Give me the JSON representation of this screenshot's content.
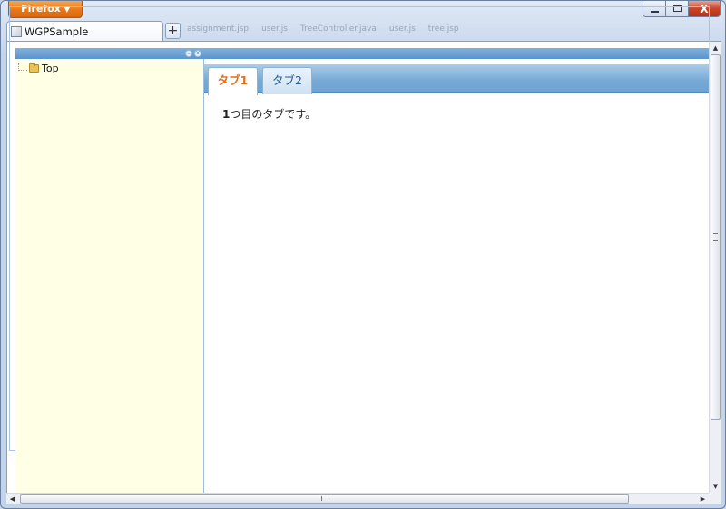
{
  "browser": {
    "menu_button": "Firefox",
    "tabs": [
      {
        "title": "WGPSample",
        "active": true
      }
    ],
    "new_tab_label": "+",
    "background_tabs": [
      "assignment.jsp",
      "user.js",
      "TreeController.java",
      "user.js",
      "tree.jsp"
    ],
    "window_controls": {
      "minimize_icon": "minimize-icon",
      "maximize_icon": "maximize-icon",
      "close_label": "X"
    }
  },
  "app": {
    "tree": {
      "root": {
        "label": "Top",
        "icon": "folder-icon"
      }
    },
    "tabs": [
      {
        "label": "タブ1",
        "active": true
      },
      {
        "label": "タブ2",
        "active": false
      }
    ],
    "tab_content": {
      "num": "1",
      "text": "つ目のタブです。"
    }
  },
  "colors": {
    "accent_orange": "#e0701b",
    "panel_header_blue": "#5b95cc",
    "tree_bg": "#ffffe6",
    "firefox_button": "#e8781a"
  }
}
